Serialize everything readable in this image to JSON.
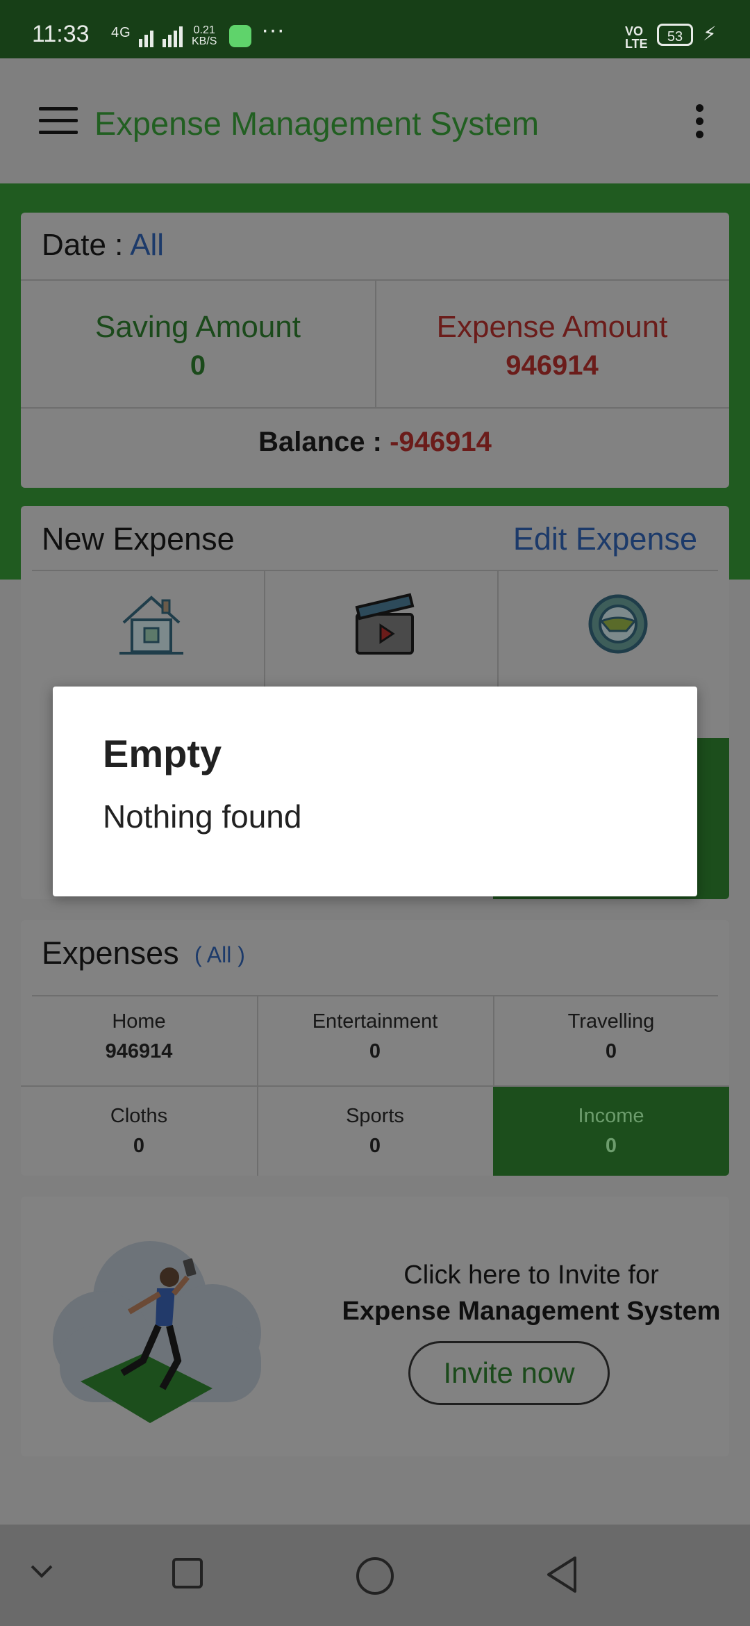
{
  "status_bar": {
    "time": "11:33",
    "network": "4G",
    "speed_value": "0.21",
    "speed_unit": "KB/S",
    "more": "···",
    "volte_top": "VO",
    "volte_bottom": "LTE",
    "battery": "53"
  },
  "toolbar": {
    "title": "Expense Management System"
  },
  "summary": {
    "date_label": "Date : ",
    "date_value": "All",
    "saving_label": "Saving Amount",
    "saving_value": "0",
    "expense_label": "Expense Amount",
    "expense_value": "946914",
    "balance_label": "Balance : ",
    "balance_value": "-946914"
  },
  "new_expense": {
    "title": "New Expense",
    "edit_link": "Edit Expense",
    "categories": [
      {
        "icon": "house-icon"
      },
      {
        "icon": "clapperboard-icon"
      },
      {
        "icon": "steering-wheel-icon"
      }
    ]
  },
  "expenses": {
    "title": "Expenses",
    "filter": "( All )",
    "cells": [
      {
        "label": "Home",
        "value": "946914"
      },
      {
        "label": "Entertainment",
        "value": "0"
      },
      {
        "label": "Travelling",
        "value": "0"
      },
      {
        "label": "Cloths",
        "value": "0"
      },
      {
        "label": "Sports",
        "value": "0"
      },
      {
        "label": "Income",
        "value": "0"
      }
    ]
  },
  "invite": {
    "line1": "Click here to Invite for",
    "line2": "Expense Management System",
    "button": "Invite now"
  },
  "dialog": {
    "title": "Empty",
    "message": "Nothing found"
  },
  "colors": {
    "brand_green": "#43a047",
    "expense_red": "#e53935",
    "link_blue": "#3a6fc4",
    "scrim": "rgba(0,0,0,0.5)"
  }
}
